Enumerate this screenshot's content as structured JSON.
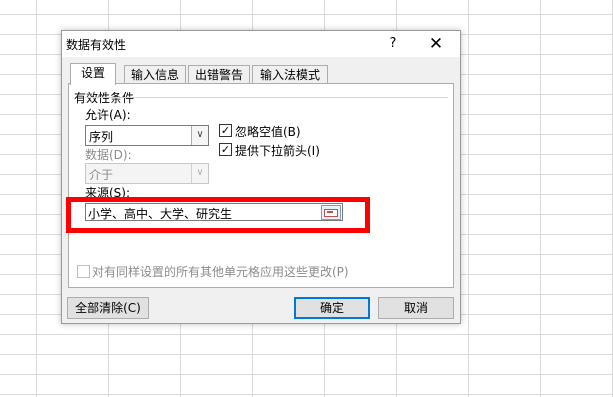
{
  "dialog": {
    "title": "数据有效性",
    "help_label": "?",
    "close_label": "✕"
  },
  "tabs": [
    {
      "label": "设置",
      "active": true
    },
    {
      "label": "输入信息"
    },
    {
      "label": "出错警告"
    },
    {
      "label": "输入法模式"
    }
  ],
  "settings": {
    "group_label": "有效性条件",
    "allow_label": "允许(A):",
    "allow_value": "序列",
    "ignore_blank_label": "忽略空值(B)",
    "ignore_blank_checked": true,
    "dropdown_label": "提供下拉箭头(I)",
    "dropdown_checked": true,
    "data_label": "数据(D):",
    "data_value": "介于",
    "source_label": "来源(S):",
    "source_value": "小学、高中、大学、研究生",
    "apply_all_label": "对有同样设置的所有其他单元格应用这些更改(P)",
    "apply_all_checked": false
  },
  "buttons": {
    "clear_all": "全部清除(C)",
    "ok": "确定",
    "cancel": "取消"
  },
  "icons": {
    "check": "✓",
    "dropdown_arrow": "∨",
    "range_select": "range-select-icon"
  },
  "colors": {
    "highlight": "#ff0000",
    "primary_border": "#0078d7"
  }
}
